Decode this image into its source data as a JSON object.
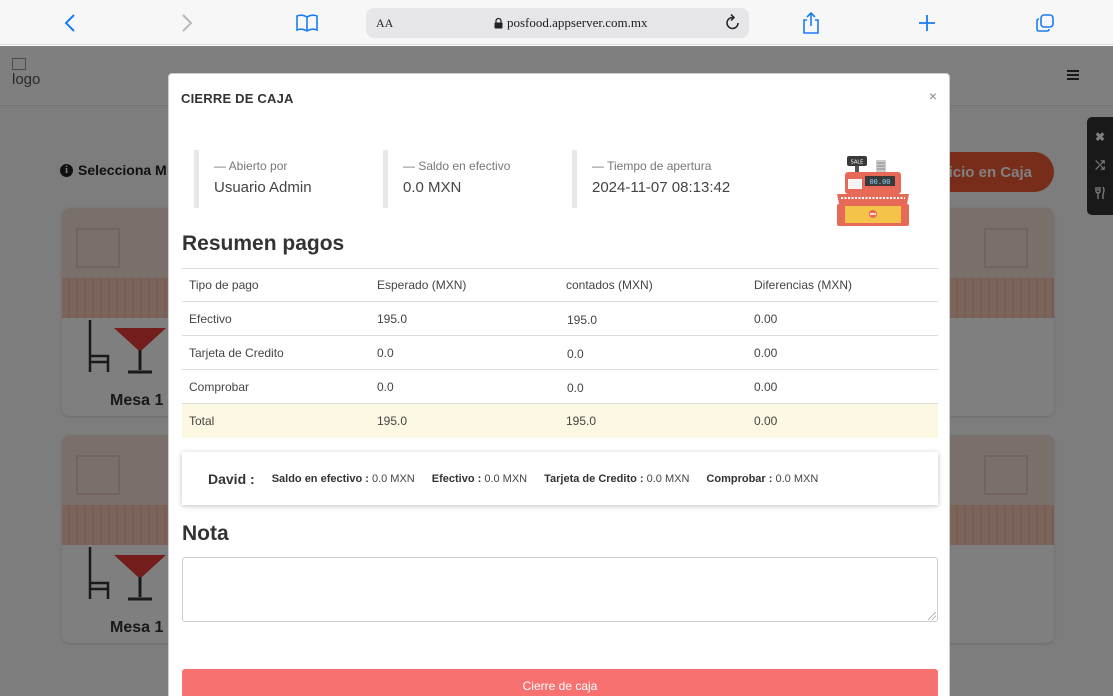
{
  "browser": {
    "url_aa": "AA",
    "url": "posfood.appserver.com.mx"
  },
  "app": {
    "logo_alt": "logo",
    "select_label": "Selecciona M",
    "inicio_button": "icio en Caja",
    "tables": [
      {
        "label": "Mesa 1"
      },
      {
        "label": "Mesa 1"
      }
    ],
    "side_tools": [
      "✖",
      "⤮",
      "🍴"
    ]
  },
  "modal": {
    "title": "CIERRE DE CAJA",
    "close": "×",
    "stats": [
      {
        "label": "— Abierto por",
        "value": "Usuario Admin"
      },
      {
        "label": "— Saldo en efectivo",
        "value": "0.0 MXN"
      },
      {
        "label": "— Tiempo de apertura",
        "value": "2024-11-07 08:13:42"
      }
    ],
    "register_display": "00.00",
    "register_sale": "SALE",
    "payments_heading": "Resumen pagos",
    "payments_table": {
      "headers": [
        "Tipo de pago",
        "Esperado (MXN)",
        "contados (MXN)",
        "Diferencias (MXN)"
      ],
      "rows": [
        {
          "tipo": "Efectivo",
          "esperado": "195.0",
          "contados": "195.0",
          "diferencias": "0.00"
        },
        {
          "tipo": "Tarjeta de Credito",
          "esperado": "0.0",
          "contados": "0.0",
          "diferencias": "0.00"
        },
        {
          "tipo": "Comprobar",
          "esperado": "0.0",
          "contados": "0.0",
          "diferencias": "0.00"
        }
      ],
      "total": {
        "tipo": "Total",
        "esperado": "195.0",
        "contados": "195.0",
        "diferencias": "0.00"
      }
    },
    "user_summary": {
      "name": "David :",
      "items": [
        {
          "label": "Saldo en efectivo :",
          "value": "0.0 MXN"
        },
        {
          "label": "Efectivo :",
          "value": "0.0 MXN"
        },
        {
          "label": "Tarjeta de Credito :",
          "value": "0.0 MXN"
        },
        {
          "label": "Comprobar :",
          "value": "0.0 MXN"
        }
      ]
    },
    "nota_heading": "Nota",
    "nota_value": "",
    "submit_button": "Cierre de caja"
  },
  "colors": {
    "accent": "#f05a37",
    "submit": "#f87171",
    "total_row": "#fcf8e3",
    "safari_icons": "#1a7cf5"
  }
}
